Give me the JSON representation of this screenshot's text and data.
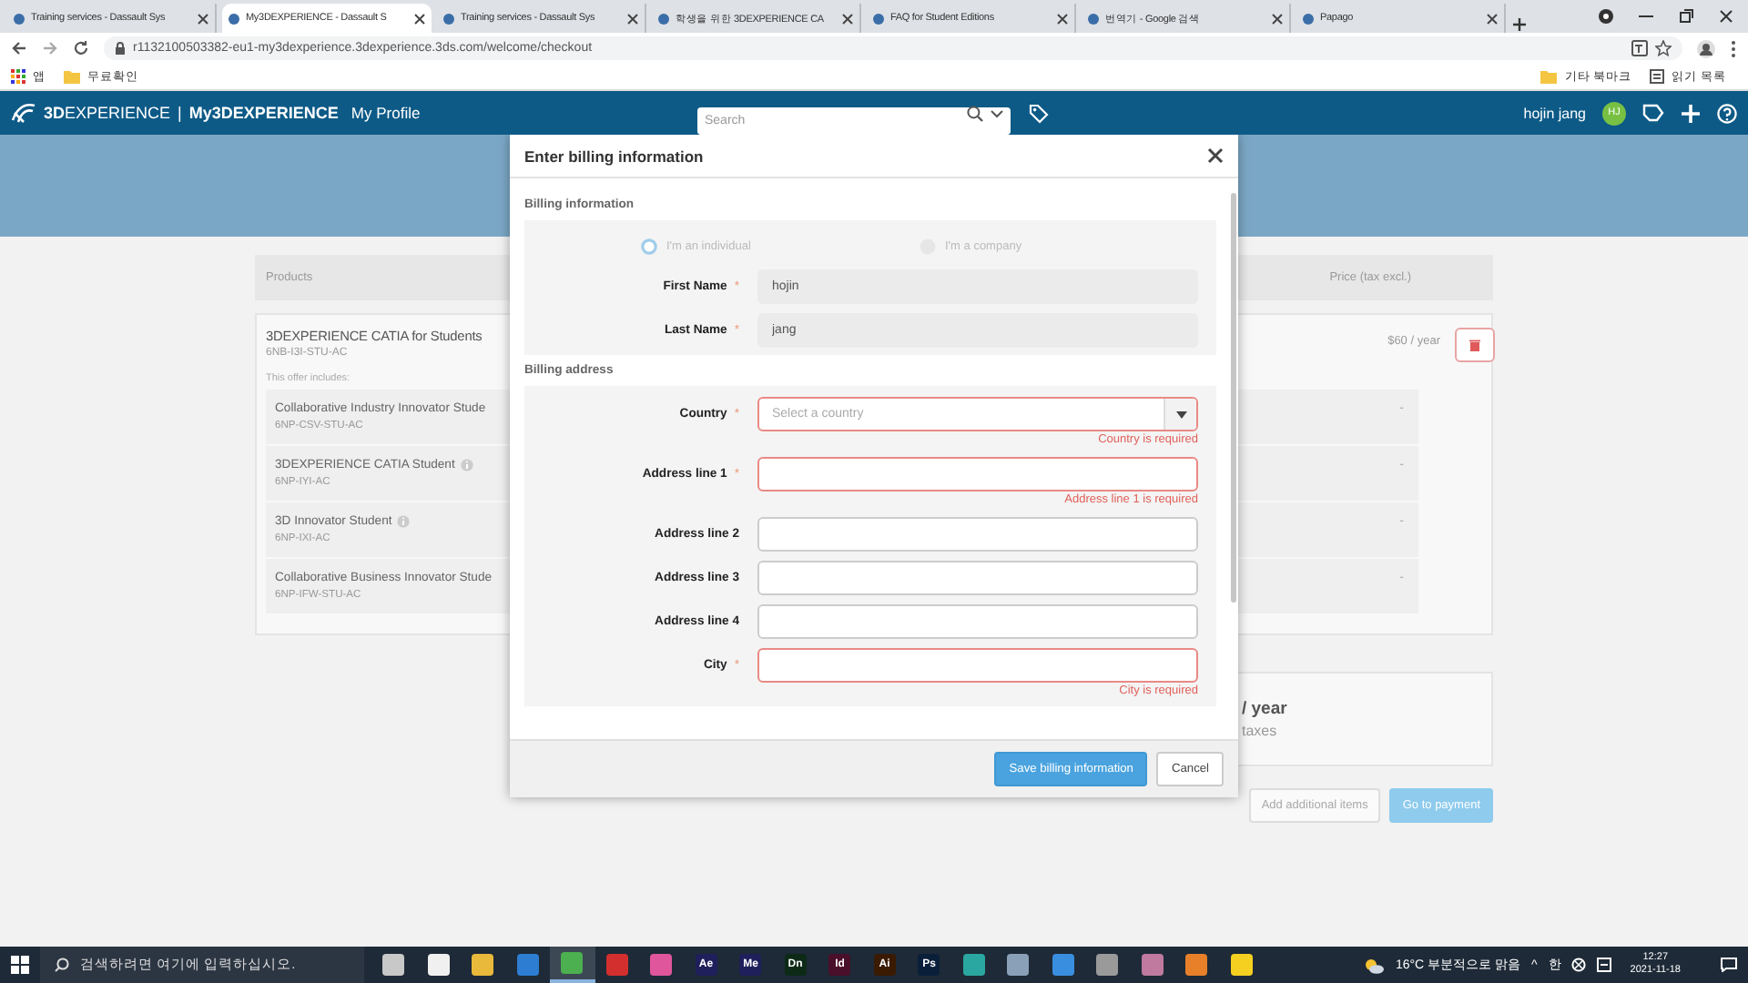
{
  "browser": {
    "tabs": [
      {
        "title": "Training services - Dassault Sys",
        "selected": false
      },
      {
        "title": "My3DEXPERIENCE - Dassault S",
        "selected": true
      },
      {
        "title": "Training services - Dassault Sys",
        "selected": false
      },
      {
        "title": "학생을 위한 3DEXPERIENCE CA",
        "selected": false
      },
      {
        "title": "FAQ for Student Editions",
        "selected": false
      },
      {
        "title": "번역기 - Google 검색",
        "selected": false
      },
      {
        "title": "Papago",
        "selected": false
      }
    ],
    "address": "r1132100503382-eu1-my3dexperience.3dexperience.3ds.com/welcome/checkout",
    "bookmarks_left": [
      "앱",
      "무료확인"
    ],
    "bookmarks_right": [
      "기타 북마크",
      "읽기 목록"
    ]
  },
  "header": {
    "brand": "**3D**EXPERIENCE",
    "separator": "|",
    "app": "My3DEXPERIENCE",
    "profile": "My Profile",
    "search": {
      "placeholder": "Search"
    },
    "user": "hojin jang",
    "avatar": "HJ"
  },
  "checkout": {
    "columns": [
      "Products",
      "Price (tax excl.)"
    ],
    "product": {
      "name": "3DEXPERIENCE CATIA for Students",
      "code": "6NB-I3I-STU-AC",
      "price": "$60 / year",
      "includes_label": "This offer includes:",
      "items": [
        {
          "name": "Collaborative Industry Innovator Stude",
          "code": "6NP-CSV-STU-AC",
          "price": "-",
          "info": false
        },
        {
          "name": "3DEXPERIENCE CATIA Student",
          "code": "6NP-IYI-AC",
          "price": "-",
          "info": true
        },
        {
          "name": "3D Innovator Student",
          "code": "6NP-IXI-AC",
          "price": "-",
          "info": true
        },
        {
          "name": "Collaborative Business Innovator Stude",
          "code": "6NP-IFW-STU-AC",
          "price": "-",
          "info": false
        }
      ]
    },
    "total": {
      "amount": "/ year",
      "note": "taxes"
    },
    "buttons": [
      {
        "label": "Add additional items",
        "kind": "secondary"
      },
      {
        "label": "Go to payment",
        "kind": "primary"
      }
    ]
  },
  "modal": {
    "title": "Enter billing information",
    "sections": [
      {
        "title": "Billing information",
        "radios": [
          {
            "label": "I'm an individual",
            "selected": true
          },
          {
            "label": "I'm a company",
            "selected": false
          }
        ],
        "fields": [
          {
            "label": "First Name",
            "required_mark": "*",
            "kind": "text",
            "value": "hojin",
            "disabled": true
          },
          {
            "label": "Last Name",
            "required_mark": "*",
            "kind": "text",
            "value": "jang",
            "disabled": true
          }
        ]
      },
      {
        "title": "Billing address",
        "fields": [
          {
            "label": "Country",
            "required_mark": "*",
            "kind": "select",
            "placeholder": "Select a country",
            "disabled": false,
            "error": "Country is required"
          },
          {
            "label": "Address line 1",
            "required_mark": "*",
            "kind": "text",
            "disabled": false,
            "error": "Address line 1 is required"
          },
          {
            "label": "Address line 2",
            "kind": "text",
            "disabled": false
          },
          {
            "label": "Address line 3",
            "kind": "text",
            "disabled": false
          },
          {
            "label": "Address line 4",
            "kind": "text",
            "disabled": false
          },
          {
            "label": "City",
            "required_mark": "*",
            "kind": "text",
            "disabled": false,
            "error": "City is required"
          }
        ]
      }
    ],
    "buttons": [
      {
        "label": "Save billing information",
        "kind": "primary"
      },
      {
        "label": "Cancel",
        "kind": "secondary"
      }
    ]
  },
  "taskbar": {
    "search_placeholder": "검색하려면 여기에 입력하십시오.",
    "apps": [
      {
        "color": "#c8c8c8",
        "active": false
      },
      {
        "color": "#f0f0f0",
        "active": false
      },
      {
        "color": "#e8b93a",
        "active": false
      },
      {
        "color": "#2d7dd2",
        "active": false
      },
      {
        "color": "#4caf50",
        "active": true
      },
      {
        "color": "#d32f2f",
        "active": false
      },
      {
        "color": "#e0569c",
        "active": false
      },
      {
        "color": "#1f1f5c",
        "label": "Ae",
        "active": false
      },
      {
        "color": "#1f1f5c",
        "label": "Me",
        "active": false
      },
      {
        "color": "#0d2a17",
        "label": "Dn",
        "active": false
      },
      {
        "color": "#4a0f2a",
        "label": "Id",
        "active": false
      },
      {
        "color": "#3a1a00",
        "label": "Ai",
        "active": false
      },
      {
        "color": "#0a1f3a",
        "label": "Ps",
        "active": false
      },
      {
        "color": "#2aa7a0",
        "active": false
      },
      {
        "color": "#8aa0b8",
        "active": false
      },
      {
        "color": "#3a8ee0",
        "active": false
      },
      {
        "color": "#9a9a9a",
        "active": false
      },
      {
        "color": "#c07aa0",
        "active": false
      },
      {
        "color": "#e8802a",
        "active": false
      },
      {
        "color": "#f5d020",
        "active": false
      }
    ],
    "weather": "16°C 부분적으로 맑음",
    "chevron": "^",
    "ime": "한",
    "time": "12:27",
    "date": "2021-11-18"
  }
}
